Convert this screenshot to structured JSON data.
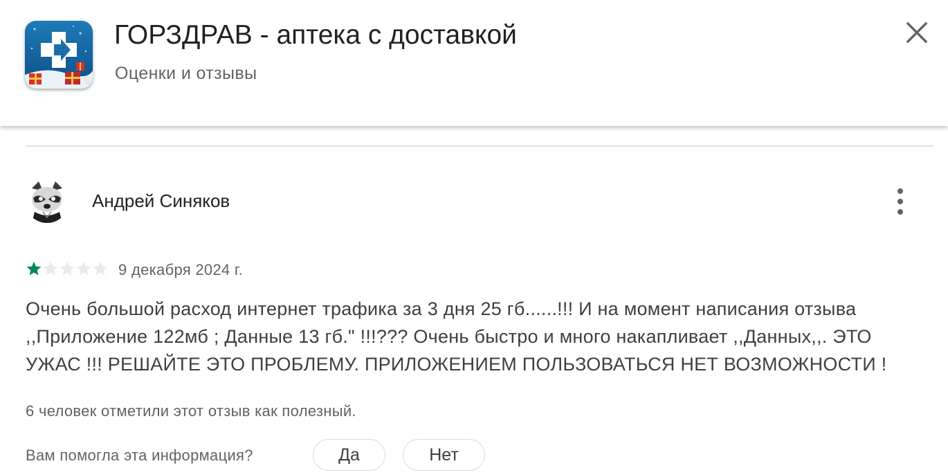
{
  "header": {
    "app_title": "ГОРЗДРАВ - аптека с доставкой",
    "subtitle": "Оценки и отзывы",
    "close_icon": "close-icon",
    "app_icon": "gorzdrav-app-icon"
  },
  "review": {
    "author": "Андрей Синяков",
    "avatar": "raccoon-avatar",
    "menu_icon": "more-vert-icon",
    "rating": 1,
    "rating_max": 5,
    "date": "9 декабря 2024 г.",
    "text_lines": [
      "Очень большой расход интернет трафика за 3 дня 25 гб......!!! И на момент написания отзыва",
      ",,Приложение 122мб ; Данные 13 гб.\" !!!??? Очень быстро и много накапливает ,,Данных,,. ЭТО",
      "УЖАС !!! РЕШАЙТЕ ЭТО ПРОБЛЕМУ. ПРИЛОЖЕНИЕМ ПОЛЬЗОВАТЬСЯ НЕТ ВОЗМОЖНОСТИ !"
    ],
    "helpful_count_text": "6 человек отметили этот отзыв как полезный.",
    "helpful_question": "Вам помогла эта информация?",
    "yes_label": "Да",
    "no_label": "Нет"
  },
  "colors": {
    "star_filled": "#01875f",
    "star_empty": "#e8eaed",
    "text_primary": "#202124",
    "text_secondary": "#5f6368",
    "divider": "#e0e0e0",
    "icon_bg": "#1a6fa8"
  }
}
